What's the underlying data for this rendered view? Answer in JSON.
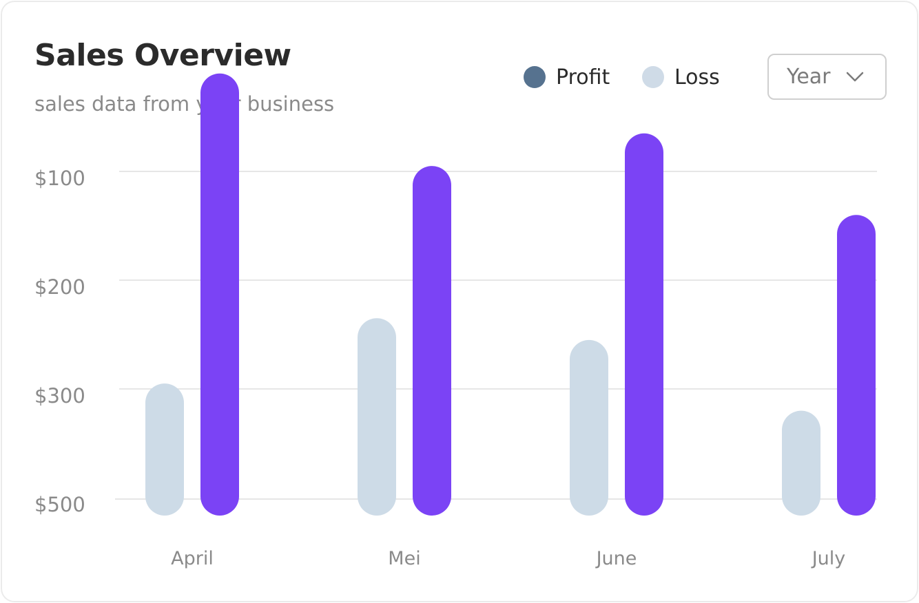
{
  "header": {
    "title": "Sales Overview",
    "subtitle": "sales data from your business"
  },
  "legend": [
    {
      "label": "Profit",
      "color": "#56728f"
    },
    {
      "label": "Loss",
      "color": "#cfdbe7"
    }
  ],
  "period_select": {
    "selected": "Year",
    "icon": "chevron-down-icon"
  },
  "colors": {
    "loss_bar": "#cddbe7",
    "profit_bar": "#7b43f5",
    "grid": "#e6e6e6",
    "axis_text": "#8a8a8a"
  },
  "chart_data": {
    "type": "bar",
    "categories": [
      "April",
      "Mei",
      "June",
      "July"
    ],
    "y_ticks": [
      "$100",
      "$200",
      "$300",
      "$500"
    ],
    "series": [
      {
        "name": "Loss",
        "values": [
          205,
          265,
          245,
          180
        ]
      },
      {
        "name": "Profit",
        "values": [
          490,
          405,
          435,
          360
        ]
      }
    ],
    "grid": true,
    "legend_position": "top-right"
  }
}
